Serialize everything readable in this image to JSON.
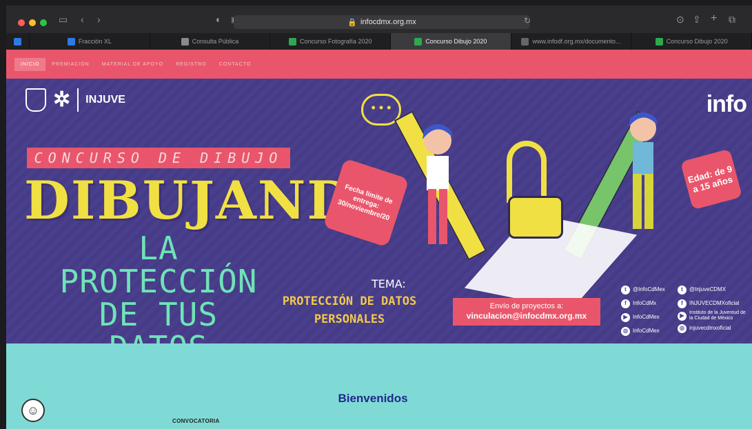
{
  "browser": {
    "url": "infocdmx.org.mx",
    "tabs": [
      {
        "label": "Fracción XL",
        "color": "#2c7be5"
      },
      {
        "label": "Consulta Pública",
        "color": "#8a8a8a"
      },
      {
        "label": "Concurso Fotografía 2020",
        "color": "#2fa84f"
      },
      {
        "label": "Concurso Dibujo 2020",
        "color": "#2fa84f",
        "active": true
      },
      {
        "label": "www.infodf.org.mx/documento...",
        "color": "#666"
      },
      {
        "label": "Concurso Dibujo 2020",
        "color": "#2fa84f"
      }
    ]
  },
  "nav": {
    "items": [
      "INICIO",
      "PREMIACIÓN",
      "MATERIAL DE APOYO",
      "REGISTRO",
      "CONTACTO"
    ]
  },
  "banner": {
    "injuve": "INJUVE",
    "info_logo": "info",
    "concurso": "CONCURSO DE DIBUJO",
    "dibujando": "DIBUJANDO",
    "proteccion": "LA PROTECCIÓN DE TUS DATOS",
    "fecha": "Fecha límite de entrega: 30/noviembre/20",
    "tema": "TEMA:",
    "tema_text": "PROTECCIÓN DE DATOS PERSONALES",
    "envio_label": "Envío de proyectos a:",
    "envio_email": "vinculacion@infocdmx.org.mx",
    "edad": "Edad: de 9 a 15 años",
    "social_left": [
      "@InfoCdMex",
      "InfoCdMx",
      "InfoCdMex",
      "InfoCdMex"
    ],
    "social_right": [
      "@InjuveCDMX",
      "INJUVECDMXoficial",
      "Instituto de la Juventud de la Ciudad de México",
      "injuvecdmxoficial"
    ]
  },
  "content": {
    "bienvenidos": "Bienvenidos",
    "convocatoria": "CONVOCATORIA"
  },
  "colors": {
    "nav_bg": "#e9566b",
    "banner_bg": "#4a3f8c",
    "content_bg": "#7fdad6",
    "title_yellow": "#f1e043",
    "title_green": "#6fe3b7"
  }
}
